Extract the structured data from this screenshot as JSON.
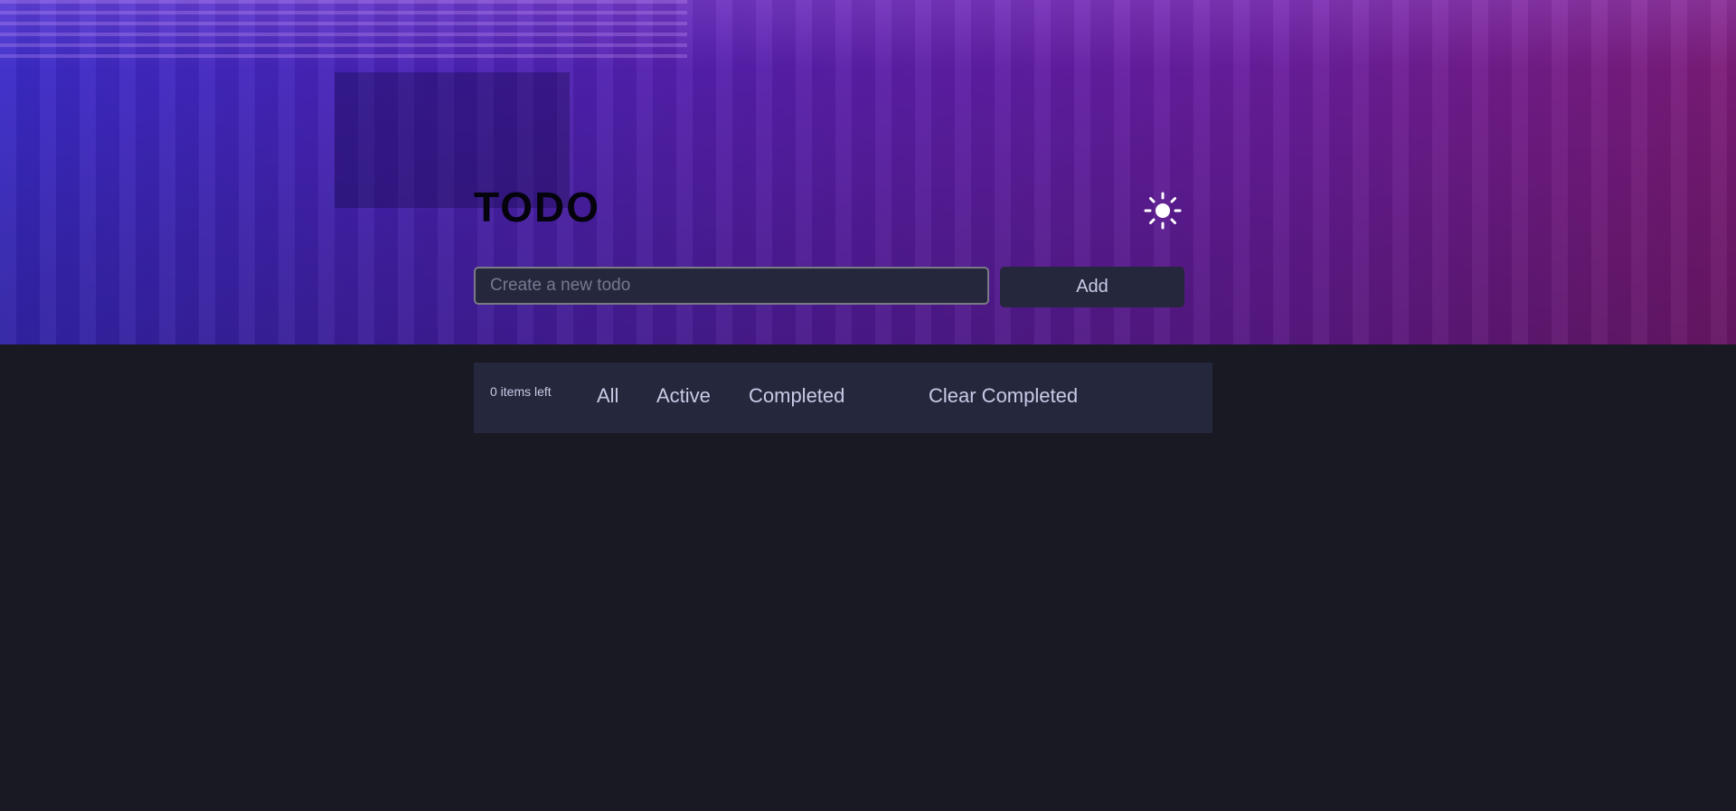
{
  "header": {
    "title": "TODO",
    "theme_toggle_icon": "sun-icon"
  },
  "new_todo": {
    "placeholder": "Create a new todo",
    "value": "",
    "add_label": "Add"
  },
  "footer": {
    "items_left": "0 items left",
    "filters": [
      "All",
      "Active",
      "Completed"
    ],
    "clear_label": "Clear Completed"
  },
  "colors": {
    "background": "#181923",
    "panel": "#25273c",
    "text": "#c8cbe7",
    "gradient_start": "#3b2bc8",
    "gradient_end": "#7c1b78"
  }
}
